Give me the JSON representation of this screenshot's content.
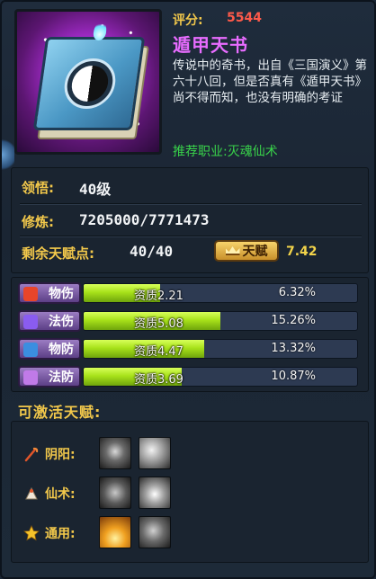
{
  "item": {
    "score_label": "评分:",
    "score_value": "5544",
    "name": "遁甲天书",
    "description": "传说中的奇书，出自《三国演义》第六十八回，但是否真有《遁甲天书》尚不得而知，也没有明确的考证",
    "career": "推荐职业:灭魂仙术",
    "icon": "book-icon"
  },
  "stats": {
    "comprehension_label": "领悟:",
    "comprehension_value": "40级",
    "cultivation_label": "修炼:",
    "cultivation_value": "7205000/7771473",
    "talent_points_label": "剩余天赋点:",
    "talent_points_value": "40/40",
    "talent_button_label": "天赋",
    "talent_value": "7.42"
  },
  "attributes": [
    {
      "label": "物伤",
      "aptitude": "资质2.21",
      "percent": "6.32%",
      "fill": 0.28,
      "icon": "sword-icon",
      "icon_color": "#e8452a"
    },
    {
      "label": "法伤",
      "aptitude": "资质5.08",
      "percent": "15.26%",
      "fill": 0.5,
      "icon": "magic-icon",
      "icon_color": "#8a5cf0"
    },
    {
      "label": "物防",
      "aptitude": "资质4.47",
      "percent": "13.32%",
      "fill": 0.44,
      "icon": "shield-icon",
      "icon_color": "#3b8ee0"
    },
    {
      "label": "法防",
      "aptitude": "资质3.69",
      "percent": "10.87%",
      "fill": 0.36,
      "icon": "wing-icon",
      "icon_color": "#c07ae8"
    }
  ],
  "talents": {
    "title": "可激活天赋:",
    "rows": [
      {
        "label": "阴阳:",
        "icon": "staff-icon"
      },
      {
        "label": "仙术:",
        "icon": "fan-icon"
      },
      {
        "label": "通用:",
        "icon": "star-icon"
      }
    ]
  }
}
